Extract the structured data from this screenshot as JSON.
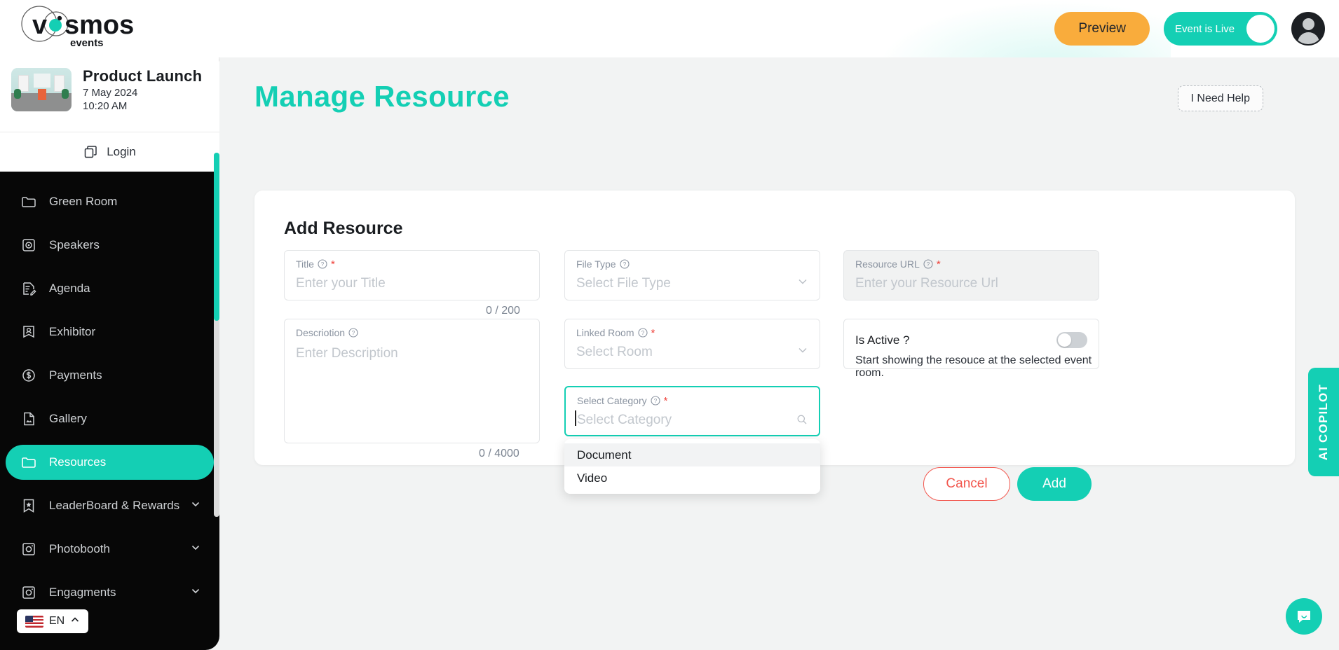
{
  "brand": {
    "logo_text": "vosmos",
    "logo_sub": "events",
    "accent_color": "#14cfb4",
    "orange_color": "#f9ac3c",
    "danger_color": "#f2574e"
  },
  "topbar": {
    "preview_label": "Preview",
    "live_toggle_label": "Event is Live",
    "live_toggle_on": true,
    "avatar_icon": "user-avatar-icon"
  },
  "sidebar": {
    "event": {
      "title": "Product Launch",
      "date": "7 May 2024",
      "time": "10:20 AM",
      "thumb_icon": "event-thumbnail"
    },
    "login_label": "Login",
    "login_icon": "copy-icon",
    "items": [
      {
        "label": "Green Room",
        "icon": "folder-icon",
        "active": false,
        "expandable": false
      },
      {
        "label": "Speakers",
        "icon": "speaker-icon",
        "active": false,
        "expandable": false
      },
      {
        "label": "Agenda",
        "icon": "agenda-icon",
        "active": false,
        "expandable": false
      },
      {
        "label": "Exhibitor",
        "icon": "exhibitor-icon",
        "active": false,
        "expandable": false
      },
      {
        "label": "Payments",
        "icon": "payments-icon",
        "active": false,
        "expandable": false
      },
      {
        "label": "Gallery",
        "icon": "gallery-icon",
        "active": false,
        "expandable": false
      },
      {
        "label": "Resources",
        "icon": "folder-icon",
        "active": true,
        "expandable": false
      },
      {
        "label": "LeaderBoard & Rewards",
        "icon": "bookmark-star-icon",
        "active": false,
        "expandable": true
      },
      {
        "label": "Photobooth",
        "icon": "camera-icon",
        "active": false,
        "expandable": true
      },
      {
        "label": "Engagments",
        "icon": "camera-icon",
        "active": false,
        "expandable": true
      }
    ],
    "language": {
      "code": "EN",
      "flag": "us-flag-icon",
      "chevron": "chevron-up-icon"
    }
  },
  "page": {
    "title": "Manage Resource",
    "help_label": "I Need Help"
  },
  "form": {
    "heading": "Add Resource",
    "title_field": {
      "label": "Title",
      "placeholder": "Enter your Title",
      "value": "",
      "required": true,
      "counter": "0 / 200"
    },
    "description": {
      "label": "Descriotion",
      "placeholder": "Enter Description",
      "value": "",
      "required": false,
      "counter": "0 / 4000"
    },
    "file_type": {
      "label": "File Type",
      "placeholder": "Select File Type",
      "value": "",
      "required": false
    },
    "linked_room": {
      "label": "Linked Room",
      "placeholder": "Select Room",
      "value": "",
      "required": true
    },
    "resource_url": {
      "label": "Resource URL",
      "placeholder": "Enter your Resource Url",
      "value": "",
      "required": true,
      "disabled": true
    },
    "select_category": {
      "label": "Select Category",
      "placeholder": "Select Category",
      "value": "",
      "required": true,
      "focused": true
    },
    "category_options": [
      {
        "label": "Document",
        "highlighted": true
      },
      {
        "label": "Video",
        "highlighted": false
      }
    ],
    "is_active": {
      "label": "Is Active ?",
      "description": "Start showing the resouce at the selected event room.",
      "on": false
    },
    "cancel_label": "Cancel",
    "add_label": "Add"
  },
  "copilot": {
    "label": "AI COPILOT"
  },
  "chat": {
    "icon": "chat-bubble-icon"
  }
}
